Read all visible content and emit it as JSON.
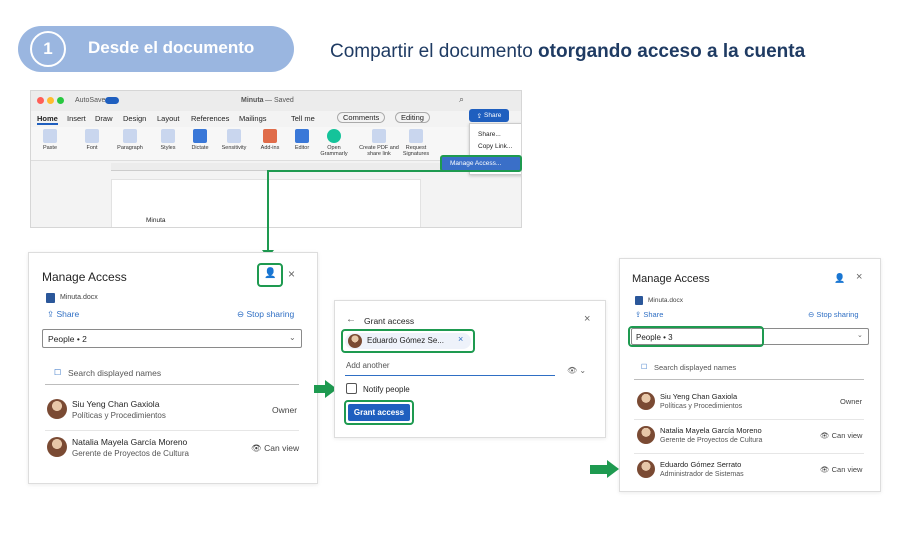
{
  "header": {
    "step_number": "1",
    "step_title": "Desde el documento",
    "headline_plain": "Compartir el documento ",
    "headline_bold": "otorgando acceso a la cuenta"
  },
  "word": {
    "autosave": "AutoSave",
    "doc_name": "Minuta",
    "saved_status": "— Saved",
    "tabs": [
      "Home",
      "Insert",
      "Draw",
      "Design",
      "Layout",
      "References",
      "Mailings",
      "Tell me"
    ],
    "comments_label": "Comments",
    "editing_label": "Editing",
    "share_label": "Share",
    "tools": [
      "Paste",
      "Font",
      "Paragraph",
      "Styles",
      "Dictate",
      "Sensitivity",
      "Add-ins",
      "Editor",
      "Open Grammarly",
      "Create PDF and share link",
      "Request Signatures"
    ],
    "share_menu": [
      "Share...",
      "Copy Link...",
      "Manage Access..."
    ],
    "doc_text": "Minuta"
  },
  "panel1": {
    "title": "Manage Access",
    "file": "Minuta.docx",
    "share": "Share",
    "stop": "Stop sharing",
    "people": "People • 2",
    "search": "Search displayed names",
    "rows": [
      {
        "name": "Siu Yeng Chan Gaxiola",
        "role": "Políticas y Procedimientos",
        "perm": "Owner"
      },
      {
        "name": "Natalia Mayela García Moreno",
        "role": "Gerente de Proyectos de Cultura",
        "perm": "Can view"
      }
    ]
  },
  "panel2": {
    "title": "Grant access",
    "chip": "Eduardo Gómez Se...",
    "add_another": "Add another",
    "notify": "Notify people",
    "button": "Grant access"
  },
  "panel3": {
    "title": "Manage Access",
    "file": "Minuta.docx",
    "share": "Share",
    "stop": "Stop sharing",
    "people": "People • 3",
    "search": "Search displayed names",
    "rows": [
      {
        "name": "Siu Yeng Chan Gaxiola",
        "role": "Políticas y Procedimientos",
        "perm": "Owner"
      },
      {
        "name": "Natalia Mayela García Moreno",
        "role": "Gerente de Proyectos de Cultura",
        "perm": "Can view"
      },
      {
        "name": "Eduardo Gómez Serrato",
        "role": "Administrador de Sistemas",
        "perm": "Can view"
      }
    ]
  },
  "colors": {
    "accent": "#1e9a50",
    "brand": "#1f5fbf",
    "pill": "#9ab6e0"
  }
}
